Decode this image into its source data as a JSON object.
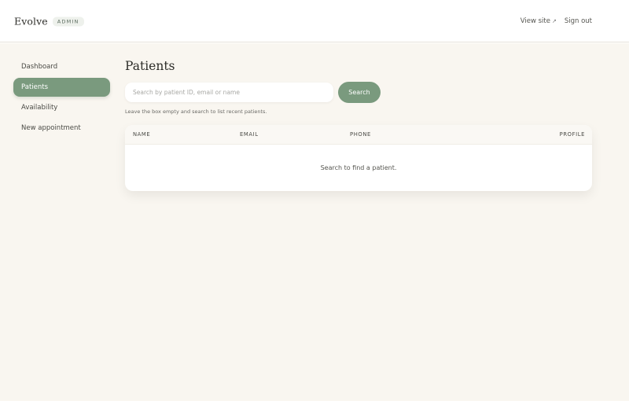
{
  "header": {
    "brand": "Evolve",
    "badge": "ADMIN",
    "view_site": "View site",
    "view_site_icon": "external-link-icon",
    "sign_out": "Sign out"
  },
  "sidebar": {
    "items": [
      {
        "label": "Dashboard",
        "active": false
      },
      {
        "label": "Patients",
        "active": true
      },
      {
        "label": "Availability",
        "active": false
      },
      {
        "label": "New appointment",
        "active": false
      }
    ]
  },
  "main": {
    "title": "Patients",
    "search": {
      "placeholder": "Search by patient ID, email or name",
      "value": "",
      "button_label": "Search"
    },
    "hint": "Leave the box empty and search to list recent patients.",
    "table": {
      "columns": [
        "NAME",
        "EMAIL",
        "PHONE",
        "PROFILE"
      ],
      "empty_message": "Search to find a patient."
    }
  },
  "colors": {
    "accent": "#7a9a7e",
    "page_background": "#f9f6f0",
    "card_background": "#ffffff"
  }
}
